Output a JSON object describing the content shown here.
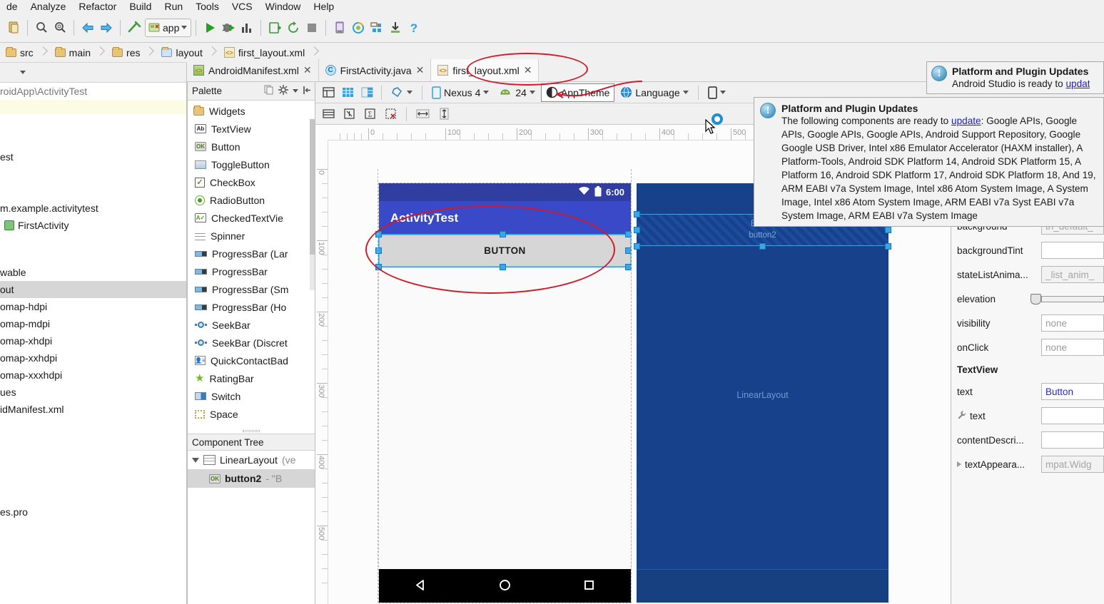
{
  "menubar": {
    "items": [
      "de",
      "Analyze",
      "Refactor",
      "Build",
      "Run",
      "Tools",
      "VCS",
      "Window",
      "Help"
    ]
  },
  "toolbar": {
    "run_config": "app",
    "icons": [
      "paste-icon",
      "search-icon",
      "search-structurally-icon",
      "navigate-back-icon",
      "navigate-forward-icon",
      "build-hammer-icon",
      "run-icon",
      "debug-icon",
      "profiler-icon",
      "install-apk-icon",
      "sync-gradle-icon",
      "stop-icon",
      "avd-manager-icon",
      "sdk-manager-icon",
      "layout-inspector-icon",
      "download-icon",
      "help-icon"
    ]
  },
  "breadcrumb": {
    "items": [
      {
        "label": "src",
        "icon": "folder-icon"
      },
      {
        "label": "main",
        "icon": "folder-icon"
      },
      {
        "label": "res",
        "icon": "res-folder-icon"
      },
      {
        "label": "layout",
        "icon": "layout-folder-icon"
      },
      {
        "label": "first_layout.xml",
        "icon": "xml-file-icon"
      }
    ]
  },
  "project": {
    "path": "roidApp\\ActivityTest",
    "rows": [
      {
        "label": "",
        "type": "highlight"
      },
      {
        "label": "",
        "type": "blank"
      },
      {
        "label": "",
        "type": "blank"
      },
      {
        "label": "est",
        "type": "plain"
      },
      {
        "label": "",
        "type": "blank"
      },
      {
        "label": "m.example.activitytest",
        "type": "plain"
      },
      {
        "label": "FirstActivity",
        "type": "class",
        "icon": "java-class-icon"
      },
      {
        "label": "",
        "type": "blank"
      },
      {
        "label": "wable",
        "type": "plain"
      },
      {
        "label": "out",
        "type": "selected"
      },
      {
        "label": "omap-hdpi",
        "type": "plain"
      },
      {
        "label": "omap-mdpi",
        "type": "plain"
      },
      {
        "label": "omap-xhdpi",
        "type": "plain"
      },
      {
        "label": "omap-xxhdpi",
        "type": "plain"
      },
      {
        "label": "omap-xxxhdpi",
        "type": "plain"
      },
      {
        "label": "ues",
        "type": "plain"
      },
      {
        "label": "idManifest.xml",
        "type": "plain"
      },
      {
        "label": "",
        "type": "blank"
      },
      {
        "label": "",
        "type": "blank"
      },
      {
        "label": "",
        "type": "blank"
      },
      {
        "label": "",
        "type": "blank"
      },
      {
        "label": "es.pro",
        "type": "plain"
      }
    ]
  },
  "editor_tabs": [
    {
      "label": "AndroidManifest.xml",
      "icon": "android-xml-icon",
      "active": false,
      "closable": true
    },
    {
      "label": "FirstActivity.java",
      "icon": "java-class-icon",
      "active": false,
      "closable": true
    },
    {
      "label": "first_layout.xml",
      "icon": "layout-xml-icon",
      "active": true,
      "closable": true
    }
  ],
  "palette": {
    "title": "Palette",
    "group": "Widgets",
    "items": [
      {
        "label": "TextView",
        "icon": "textview-icon"
      },
      {
        "label": "Button",
        "icon": "button-icon"
      },
      {
        "label": "ToggleButton",
        "icon": "togglebutton-icon"
      },
      {
        "label": "CheckBox",
        "icon": "checkbox-icon"
      },
      {
        "label": "RadioButton",
        "icon": "radiobutton-icon"
      },
      {
        "label": "CheckedTextVie",
        "icon": "checkedtextview-icon"
      },
      {
        "label": "Spinner",
        "icon": "spinner-icon"
      },
      {
        "label": "ProgressBar (Lar",
        "icon": "progressbar-icon"
      },
      {
        "label": "ProgressBar",
        "icon": "progressbar-icon"
      },
      {
        "label": "ProgressBar (Sm",
        "icon": "progressbar-icon"
      },
      {
        "label": "ProgressBar (Ho",
        "icon": "progressbar-icon"
      },
      {
        "label": "SeekBar",
        "icon": "seekbar-icon"
      },
      {
        "label": "SeekBar (Discret",
        "icon": "seekbar-icon"
      },
      {
        "label": "QuickContactBad",
        "icon": "quickcontactbadge-icon"
      },
      {
        "label": "RatingBar",
        "icon": "ratingbar-icon"
      },
      {
        "label": "Switch",
        "icon": "switch-icon"
      },
      {
        "label": "Space",
        "icon": "space-icon"
      }
    ]
  },
  "component_tree": {
    "title": "Component Tree",
    "rows": [
      {
        "label": "LinearLayout",
        "suffix": "(ve",
        "icon": "linearlayout-icon",
        "depth": 0,
        "selected": false,
        "bold": false
      },
      {
        "label": "button2",
        "suffix": "- \"B",
        "icon": "button-icon",
        "depth": 1,
        "selected": true,
        "bold": true
      }
    ]
  },
  "designer_toolbar": {
    "device": "Nexus 4",
    "api_level": "24",
    "theme": "AppTheme",
    "language": "Language",
    "icons_left": [
      "design-mode-icon",
      "blueprint-mode-icon",
      "both-modes-icon"
    ],
    "orientation_icon": "rotate-icon",
    "device_icon": "phone-icon",
    "api_icon": "android-icon",
    "theme_icon": "theme-icon",
    "language_icon": "globe-icon",
    "virtual_device_icon": "phone-icon",
    "row2_icons": [
      "baseline-align-icon",
      "vertical-align-icon",
      "expand-all-icon",
      "clear-constraints-icon",
      "expand-horizontal-icon",
      "expand-vertical-icon"
    ]
  },
  "canvas": {
    "ruler_h_labels": [
      "0",
      "100",
      "200",
      "300",
      "400",
      "500"
    ],
    "ruler_v_labels": [
      "0",
      "100",
      "200",
      "300",
      "400",
      "500"
    ],
    "device_preview": {
      "status_time": "6:00",
      "status_icons": [
        "wifi-icon",
        "battery-icon"
      ],
      "app_title": "ActivityTest",
      "button_label": "BUTTON",
      "nav_icons": [
        "back-icon",
        "home-icon",
        "recents-icon"
      ]
    },
    "blueprint": {
      "button_line1": "Button",
      "button_line2": "button2",
      "root_label": "LinearLayout"
    }
  },
  "notifications": {
    "small": {
      "title": "Platform and Plugin Updates",
      "body_prefix": "Android Studio is ready to ",
      "link": "updat"
    },
    "large": {
      "title": "Platform and Plugin Updates",
      "body_prefix": "The following components are ready to ",
      "link": "update",
      "body_rest": ": Google APIs, Google APIs, Google APIs, Google APIs, Android Support Repository, Google Google USB Driver, Intel x86 Emulator Accelerator (HAXM installer), A Platform-Tools, Android SDK Platform 14, Android SDK Platform 15, A Platform 16, Android SDK Platform 17, Android SDK Platform 18, And 19, ARM EABI v7a System Image, Intel x86 Atom System Image, A System Image, Intel x86 Atom System Image, ARM EABI v7a Syst EABI v7a System Image, ARM EABI v7a System Image"
    }
  },
  "properties": {
    "rows": [
      {
        "name": "background",
        "value": "th_default_",
        "kind": "text",
        "grayed": true,
        "partial": true
      },
      {
        "name": "backgroundTint",
        "value": "",
        "kind": "text"
      },
      {
        "name": "stateListAnima...",
        "value": "_list_anim_",
        "kind": "text",
        "grayed": true
      },
      {
        "name": "elevation",
        "value": "",
        "kind": "slider"
      },
      {
        "name": "visibility",
        "value": "none",
        "kind": "text"
      },
      {
        "name": "onClick",
        "value": "none",
        "kind": "text"
      }
    ],
    "section": "TextView",
    "section_rows": [
      {
        "name": "text",
        "value": "Button",
        "kind": "text",
        "blue": true
      },
      {
        "name": "text",
        "value": "",
        "kind": "text",
        "icon": "wrench-icon"
      },
      {
        "name": "contentDescri...",
        "value": "",
        "kind": "text"
      },
      {
        "name": "textAppeara...",
        "value": "mpat.Widg",
        "kind": "text",
        "grayed": true,
        "icon": "expand-arrow-icon"
      }
    ]
  },
  "colors": {
    "accent_blue": "#2b9fe0",
    "blueprint_bg": "#17418a",
    "appbar": "#3949c8",
    "statusbar": "#2f3ea0",
    "annotation_red": "#cf1a2b"
  }
}
